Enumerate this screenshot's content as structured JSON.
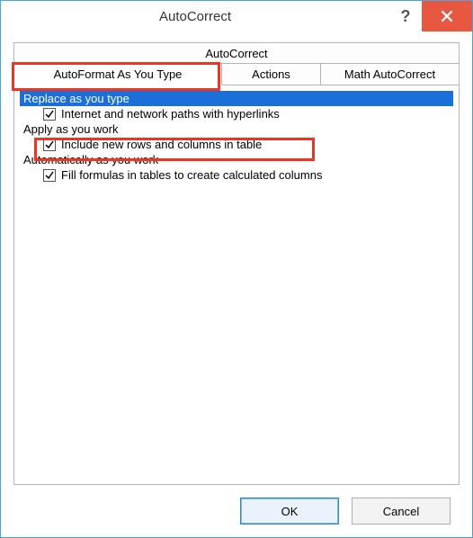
{
  "window": {
    "title": "AutoCorrect"
  },
  "tabs": {
    "top": "AutoCorrect",
    "b1": "AutoFormat As You Type",
    "b2": "Actions",
    "b3": "Math AutoCorrect"
  },
  "sections": {
    "replace_header": "Replace as you type",
    "replace_item1_label": "Internet and network paths with hyperlinks",
    "apply_header": "Apply as you work",
    "apply_item1_label": "Include new rows and columns in table",
    "auto_header": "Automatically as you work",
    "auto_item1_label": "Fill formulas in tables to create calculated columns"
  },
  "checkboxes": {
    "replace_item1": true,
    "apply_item1": true,
    "auto_item1": true
  },
  "buttons": {
    "ok": "OK",
    "cancel": "Cancel"
  }
}
